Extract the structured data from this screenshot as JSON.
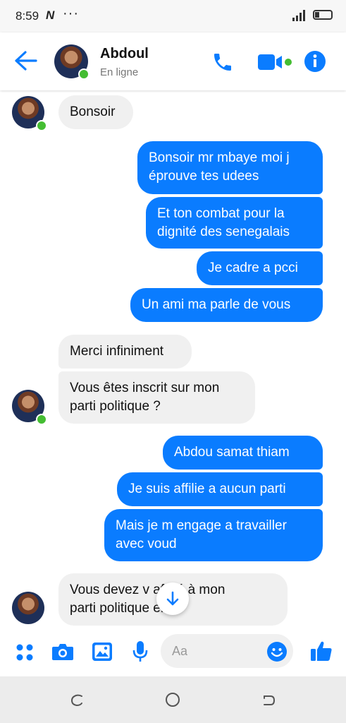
{
  "status_bar": {
    "time": "8:59",
    "app_letter": "N",
    "dots": "···"
  },
  "header": {
    "name": "Abdoul",
    "status": "En ligne"
  },
  "messages": [
    {
      "dir": "in",
      "text": "Bonsoir"
    },
    {
      "dir": "out",
      "lines": [
        "Bonsoir mr mbaye moi j",
        "éprouve tes udees"
      ]
    },
    {
      "dir": "out",
      "lines": [
        "Et ton combat pour la",
        "dignité des senegalais"
      ]
    },
    {
      "dir": "out",
      "text": "Je cadre a pcci"
    },
    {
      "dir": "out",
      "text": "Un ami ma parle de vous"
    },
    {
      "dir": "in",
      "text": "Merci infiniment"
    },
    {
      "dir": "in",
      "lines": [
        "Vous êtes inscrit sur mon",
        "parti politique ?"
      ]
    },
    {
      "dir": "out",
      "text": "Abdou samat  thiam"
    },
    {
      "dir": "out",
      "text": "Je suis affilie a aucun parti"
    },
    {
      "dir": "out",
      "lines": [
        "Mais je m engage a travailler",
        "avec voud"
      ]
    },
    {
      "dir": "in",
      "lines": [
        "Vous devez v    affilié à mon",
        "parti politique   erci."
      ]
    }
  ],
  "composer": {
    "placeholder": "Aa"
  },
  "colors": {
    "accent": "#0a7cff",
    "online": "#44bd32",
    "incoming_bubble": "#f0f0f0"
  }
}
